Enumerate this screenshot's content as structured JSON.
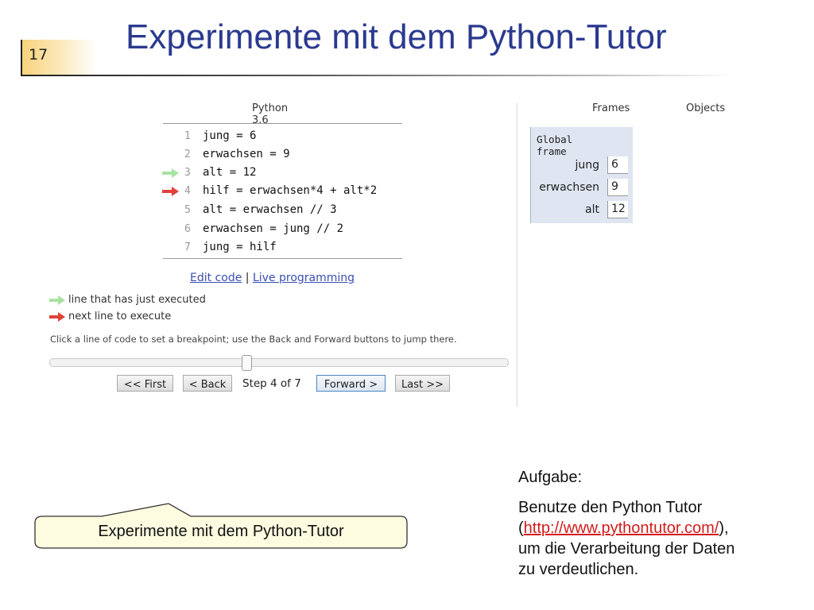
{
  "slide": {
    "number": "17",
    "title": "Experimente mit dem Python-Tutor"
  },
  "tutor": {
    "python_version": "Python 3.6",
    "code_lines": [
      {
        "num": "1",
        "src": "jung = 6",
        "arrow": ""
      },
      {
        "num": "2",
        "src": "erwachsen = 9",
        "arrow": ""
      },
      {
        "num": "3",
        "src": "alt = 12",
        "arrow": "just-executed"
      },
      {
        "num": "4",
        "src": "hilf = erwachsen*4 + alt*2",
        "arrow": "next"
      },
      {
        "num": "5",
        "src": "alt = erwachsen // 3",
        "arrow": ""
      },
      {
        "num": "6",
        "src": "erwachsen = jung // 2",
        "arrow": ""
      },
      {
        "num": "7",
        "src": "jung = hilf",
        "arrow": ""
      }
    ],
    "edit_code_link": "Edit code",
    "separator": "|",
    "live_programming_link": "Live programming",
    "legend_executed": "line that has just executed",
    "legend_next": "next line to execute",
    "hint": "Click a line of code to set a breakpoint; use the Back and Forward buttons to jump there.",
    "slider_fraction": 0.43,
    "buttons": {
      "first": "<< First",
      "back": "< Back",
      "forward": "Forward >",
      "last": "Last >>"
    },
    "step_text": "Step 4 of 7",
    "frames_header": "Frames",
    "objects_header": "Objects",
    "global_frame_title": "Global frame",
    "variables": [
      {
        "name": "jung",
        "value": "6"
      },
      {
        "name": "erwachsen",
        "value": "9"
      },
      {
        "name": "alt",
        "value": "12"
      }
    ],
    "colors": {
      "just_executed_arrow": "#a6e3a1",
      "next_arrow": "#e0433a",
      "frame_bg": "#dfe6f1",
      "link": "#3a4fb4"
    }
  },
  "caption": {
    "text": "Experimente mit dem Python-Tutor"
  },
  "task": {
    "heading": "Aufgabe:",
    "line1": "Benutze den Python Tutor",
    "paren_open": "(",
    "url": "http://www.pythontutor.com/",
    "paren_close": "),",
    "line3": "um die Verarbeitung der Daten",
    "line4": "zu verdeutlichen."
  }
}
